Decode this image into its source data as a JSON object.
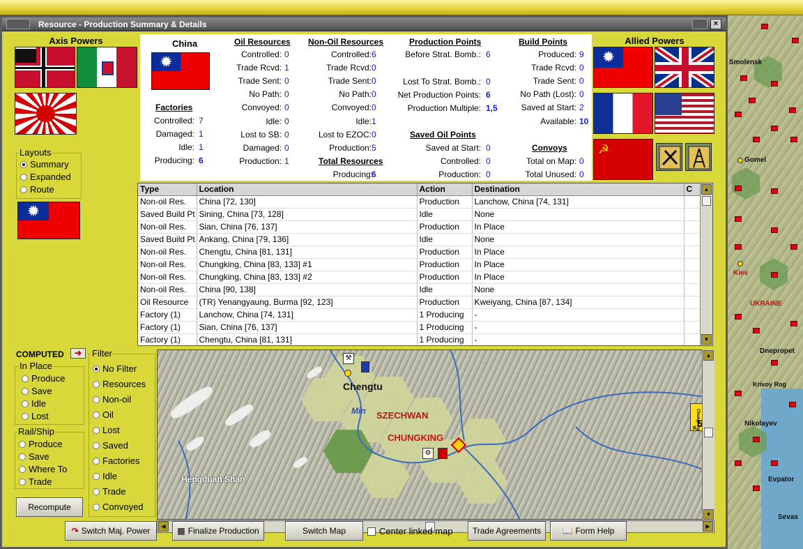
{
  "window": {
    "title": "Resource - Production Summary & Details",
    "close": "×"
  },
  "axis": {
    "title": "Axis Powers"
  },
  "allied": {
    "title": "Allied Powers"
  },
  "country": {
    "name": "China"
  },
  "factories": {
    "title": "Factories",
    "rows": [
      {
        "label": "Controlled:",
        "value": "7"
      },
      {
        "label": "Damaged:",
        "value": "1"
      },
      {
        "label": "Idle:",
        "value": "1"
      },
      {
        "label": "Producing:",
        "value": "6"
      }
    ]
  },
  "oil": {
    "title": "Oil Resources",
    "rows": [
      {
        "label": "Controlled:",
        "value": "0"
      },
      {
        "label": "Trade Rcvd:",
        "value": "1"
      },
      {
        "label": "Trade Sent:",
        "value": "0"
      },
      {
        "label": "No Path:",
        "value": "0"
      },
      {
        "label": "Convoyed:",
        "value": "0"
      },
      {
        "label": "Idle:",
        "value": "0"
      },
      {
        "label": "Lost to SB:",
        "value": "0"
      },
      {
        "label": "Damaged:",
        "value": "0"
      },
      {
        "label": "Production:",
        "value": "1"
      }
    ]
  },
  "nonoil": {
    "title": "Non-Oil Resources",
    "rows": [
      {
        "label": "Controlled:",
        "value": "6"
      },
      {
        "label": "Trade Rcvd:",
        "value": "0"
      },
      {
        "label": "Trade Sent:",
        "value": "0"
      },
      {
        "label": "No Path:",
        "value": "0"
      },
      {
        "label": "Convoyed:",
        "value": "0"
      },
      {
        "label": "Idle:",
        "value": "1"
      },
      {
        "label": "Lost to EZOC:",
        "value": "0"
      },
      {
        "label": "Production:",
        "value": "5"
      }
    ]
  },
  "total": {
    "title": "Total Resources",
    "label": "Producing:",
    "value": "6"
  },
  "pp": {
    "title": "Production Points",
    "before_label": "Before Strat. Bomb.:",
    "before": "6",
    "lost_label": "Lost To Strat. Bomb.:",
    "lost": "0",
    "net_label": "Net Production Points:",
    "net": "6",
    "mult_label": "Production Multiple:",
    "mult": "1,5"
  },
  "saved_oil": {
    "title": "Saved Oil Points",
    "rows": [
      {
        "label": "Saved at Start:",
        "value": "0"
      },
      {
        "label": "Controlled:",
        "value": "0"
      },
      {
        "label": "Production:",
        "value": "0"
      }
    ]
  },
  "bp": {
    "title": "Build Points",
    "rows": [
      {
        "label": "Produced:",
        "value": "9"
      },
      {
        "label": "Trade Rcvd:",
        "value": "0"
      },
      {
        "label": "Trade Sent:",
        "value": "0"
      },
      {
        "label": "No Path (Lost):",
        "value": "0"
      },
      {
        "label": "Saved at Start:",
        "value": "2"
      },
      {
        "label": "Available:",
        "value": "10"
      }
    ]
  },
  "convoys": {
    "title": "Convoys",
    "rows": [
      {
        "label": "Total on Map:",
        "value": "0"
      },
      {
        "label": "Total Unused:",
        "value": "0"
      }
    ]
  },
  "layouts": {
    "title": "Layouts",
    "options": [
      "Summary",
      "Expanded",
      "Route"
    ],
    "selected": 0
  },
  "table": {
    "headers": [
      "Type",
      "Location",
      "Action",
      "Destination",
      "C"
    ],
    "rows": [
      [
        "Non-oil Res.",
        "China [72, 130]",
        "Production",
        "Lanchow, China [74, 131]"
      ],
      [
        "Saved Build Pt",
        "Sining, China [73, 128]",
        "Idle",
        "None"
      ],
      [
        "Non-oil Res.",
        "Sian, China [76, 137]",
        "Production",
        "In Place"
      ],
      [
        "Saved Build Pt",
        "Ankang, China [79, 136]",
        "Idle",
        "None"
      ],
      [
        "Non-oil Res.",
        "Chengtu, China [81, 131]",
        "Production",
        "In Place"
      ],
      [
        "Non-oil Res.",
        "Chungking, China [83, 133] #1",
        "Production",
        "In Place"
      ],
      [
        "Non-oil Res.",
        "Chungking, China [83, 133] #2",
        "Production",
        "In Place"
      ],
      [
        "Non-oil Res.",
        "China [90, 138]",
        "Idle",
        "None"
      ],
      [
        "Oil Resource",
        "(TR) Yenangyaung, Burma [92, 123]",
        "Production",
        "Kweiyang, China [87, 134]"
      ],
      [
        "Factory (1)",
        "Lanchow, China [74, 131]",
        "1 Producing",
        "-"
      ],
      [
        "Factory (1)",
        "Sian, China [76, 137]",
        "1 Producing",
        "-"
      ],
      [
        "Factory (1)",
        "Chengtu, China [81, 131]",
        "1 Producing",
        "-"
      ]
    ]
  },
  "computed": {
    "label": "COMPUTED"
  },
  "inplace": {
    "title": "In Place",
    "options": [
      "Produce",
      "Save",
      "Idle",
      "Lost"
    ]
  },
  "railship": {
    "title": "Rail/Ship",
    "options": [
      "Produce",
      "Save",
      "Where To",
      "Trade"
    ]
  },
  "filter": {
    "title": "Filter",
    "options": [
      "No Filter",
      "Resources",
      "Non-oil",
      "Oil",
      "Lost",
      "Saved",
      "Factories",
      "Idle",
      "Trade",
      "Convoyed"
    ],
    "selected": 0
  },
  "recompute": {
    "label": "Recompute"
  },
  "map": {
    "labels": {
      "chengtu": "Chengtu",
      "min": "Min",
      "szechwan": "SZECHWAN",
      "chungking": "CHUNGKING",
      "hengduan": "Hengduan Shan"
    },
    "side_counter": "5",
    "side_counter_caption": "Chungking W."
  },
  "bg_map": {
    "labels": [
      "Smolensk",
      "Gomel",
      "Kiev",
      "UKRAINE",
      "Dnepropet",
      "Krivoy Rog",
      "Nikolayev",
      "Evpator",
      "Sevas"
    ]
  },
  "bottom": {
    "switch_major": "Switch Maj. Power",
    "finalize": "Finalize Production",
    "switch_map": "Switch Map",
    "center_linked": "Center linked map",
    "trade": "Trade Agreements",
    "form_help": "Form Help"
  },
  "colors": {
    "panel_bg": "#d8d83a",
    "value_blue": "#1220d0"
  }
}
